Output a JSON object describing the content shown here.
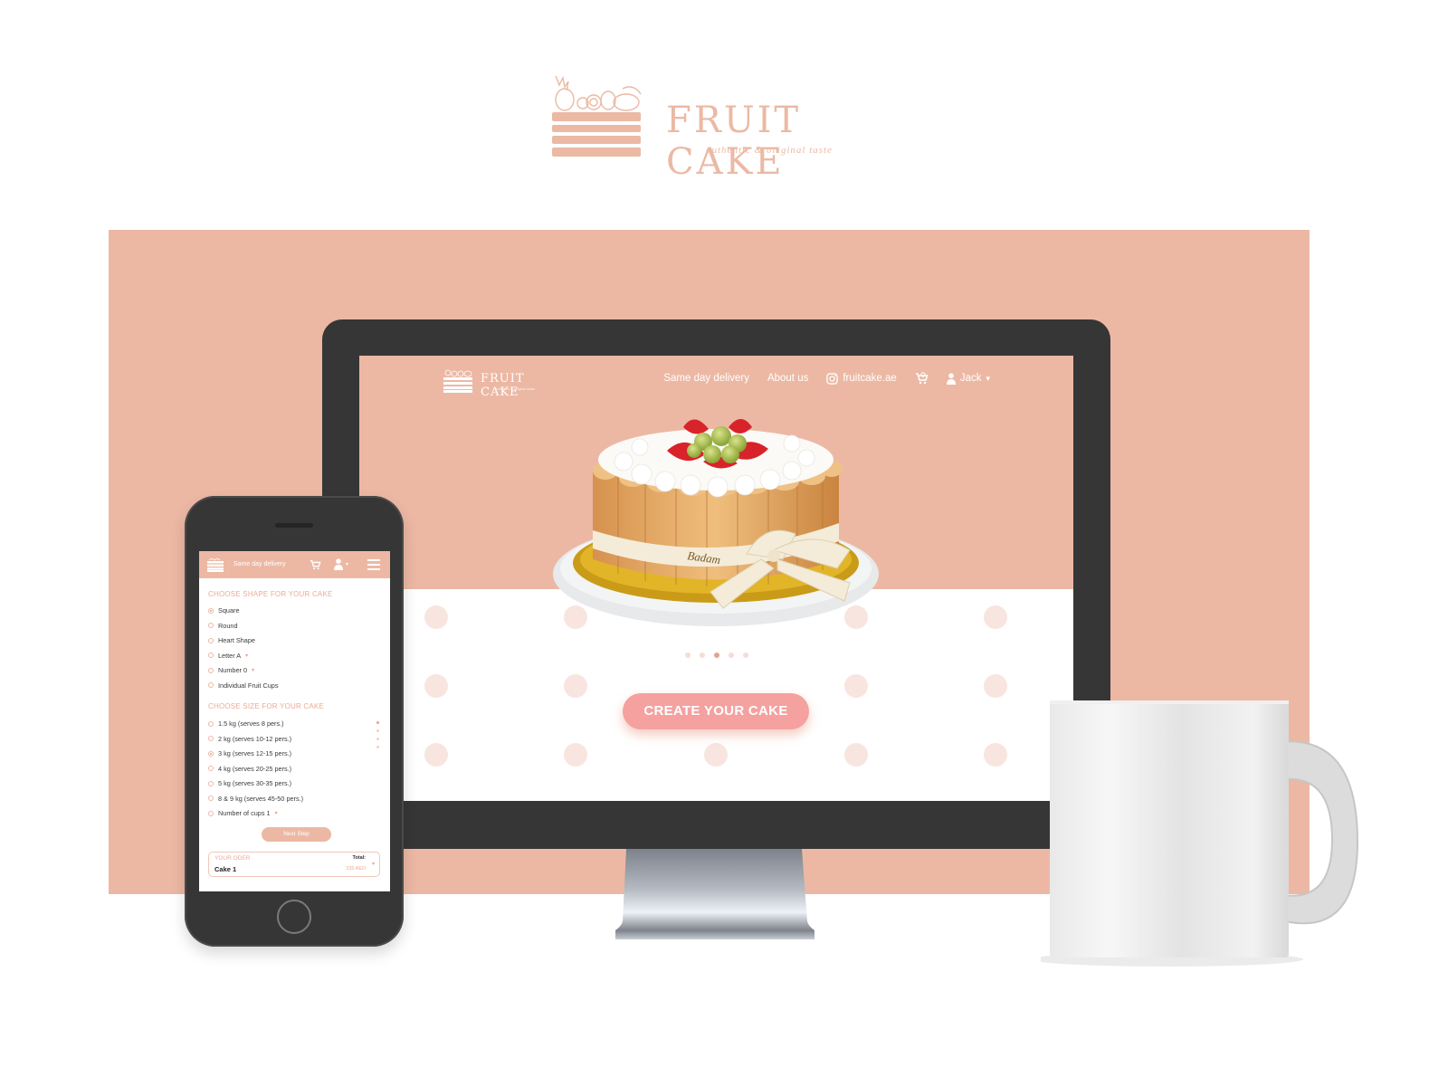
{
  "brand": {
    "name": "FRUIT CAKE",
    "tagline": "authentic & original taste",
    "accent_color": "#ecb8a4"
  },
  "desktop": {
    "nav": {
      "logo_name": "FRUIT CAKE",
      "logo_tagline": "authentic & original taste",
      "links": [
        {
          "label": "Same day delivery"
        },
        {
          "label": "About us"
        },
        {
          "label": "fruitcake.ae",
          "icon": "instagram-icon"
        }
      ],
      "cart_icon": "cart-icon",
      "user": {
        "label": "Jack",
        "icon": "user-icon",
        "caret": "▾"
      }
    },
    "hero": {
      "image": "fruit-cake-photo",
      "carousel": {
        "count": 5,
        "active_index": 2
      }
    },
    "cta_label": "CREATE YOUR CAKE"
  },
  "mobile": {
    "nav": {
      "link": "Same day delivery",
      "cart_icon": "cart-icon",
      "user_icon": "user-icon",
      "user_caret": "▾",
      "menu_icon": "hamburger-menu-icon"
    },
    "shape_section": {
      "title": "CHOOSE SHAPE FOR YOUR CAKE",
      "options": [
        {
          "label": "Square",
          "selected": true,
          "dropdown": ""
        },
        {
          "label": "Round",
          "selected": false,
          "dropdown": ""
        },
        {
          "label": "Heart Shape",
          "selected": false,
          "dropdown": ""
        },
        {
          "label": "Letter  A",
          "selected": false,
          "dropdown": "▾"
        },
        {
          "label": "Number  0",
          "selected": false,
          "dropdown": "▾"
        },
        {
          "label": "Individual Fruit Cups",
          "selected": false,
          "dropdown": ""
        }
      ]
    },
    "size_section": {
      "title": "CHOOSE SIZE FOR YOUR CAKE",
      "options": [
        {
          "label": "1.5 kg (serves 8 pers.)",
          "selected": false,
          "dropdown": ""
        },
        {
          "label": "2 kg (serves 10-12 pers.)",
          "selected": false,
          "dropdown": ""
        },
        {
          "label": "3 kg (serves 12-15 pers.)",
          "selected": true,
          "dropdown": ""
        },
        {
          "label": "4 kg (serves 20-25 pers.)",
          "selected": false,
          "dropdown": ""
        },
        {
          "label": "5 kg (serves 30-35 pers.)",
          "selected": false,
          "dropdown": ""
        },
        {
          "label": "8 & 9 kg (serves 45-50 pers.)",
          "selected": false,
          "dropdown": ""
        },
        {
          "label": "Number of cups  1",
          "selected": false,
          "dropdown": "▾"
        }
      ]
    },
    "next_step_label": "Next Step",
    "order": {
      "title": "YOUR ODER",
      "item": "Cake 1",
      "total_label": "Total:",
      "total_value": "335 AED",
      "caret": "▾"
    }
  }
}
